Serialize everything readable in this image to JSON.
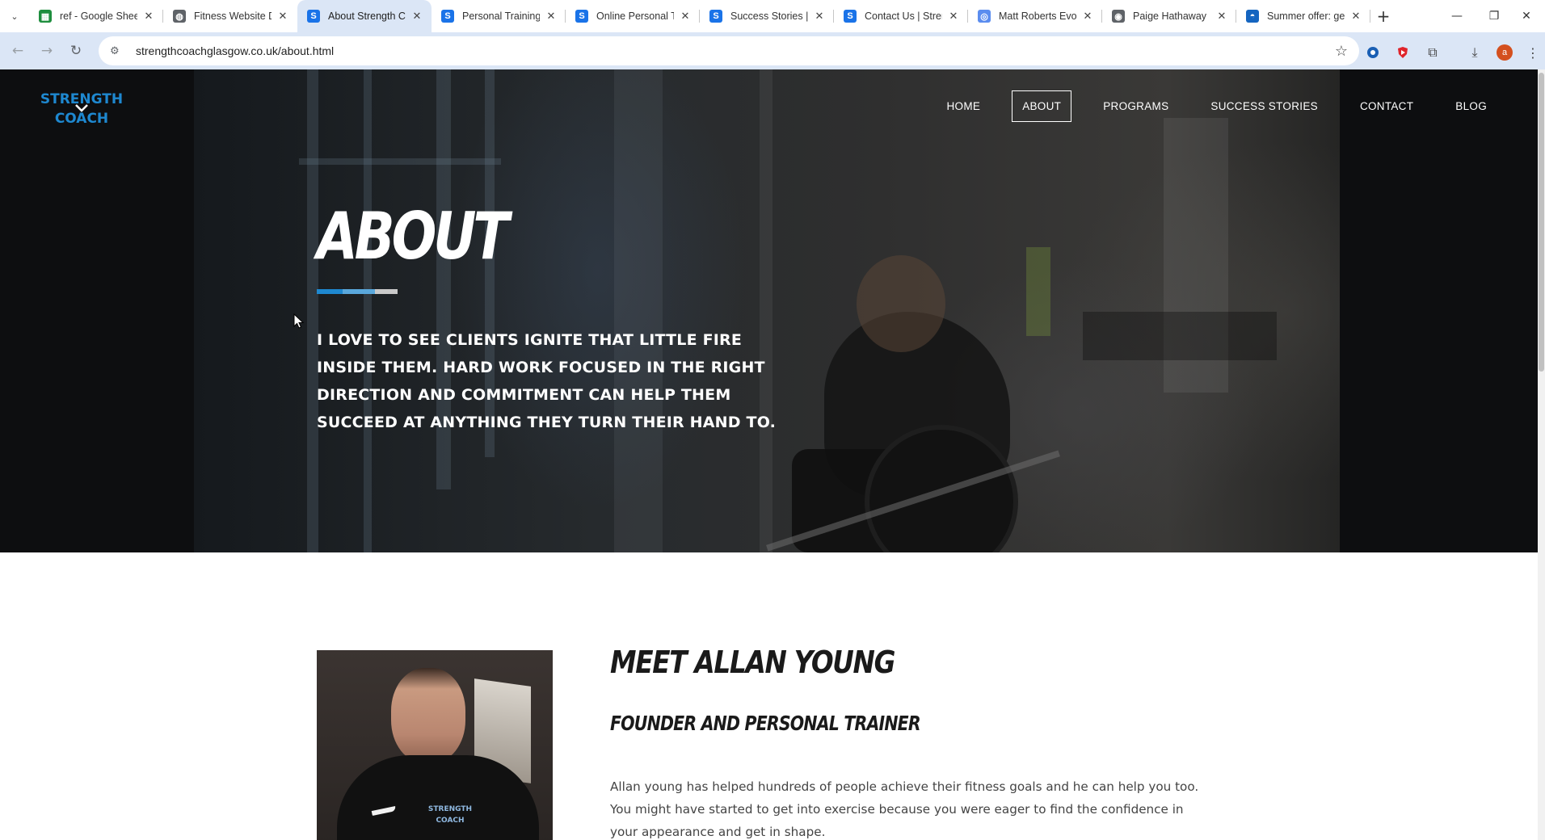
{
  "browser": {
    "tabs": [
      {
        "title": "ref - Google Shee",
        "favicon": "sheets-icon",
        "color": "#1e8e3e",
        "glyph": "▦"
      },
      {
        "title": "Fitness Website D",
        "favicon": "chat-icon",
        "color": "#5f6368",
        "glyph": "◍"
      },
      {
        "title": "About Strength C",
        "favicon": "s-logo-icon",
        "color": "#1a73e8",
        "glyph": "S"
      },
      {
        "title": "Personal Training",
        "favicon": "s-logo-icon",
        "color": "#1a73e8",
        "glyph": "S"
      },
      {
        "title": "Online Personal T",
        "favicon": "s-logo-icon",
        "color": "#1a73e8",
        "glyph": "S"
      },
      {
        "title": "Success Stories | S",
        "favicon": "s-logo-icon",
        "color": "#1a73e8",
        "glyph": "S"
      },
      {
        "title": "Contact Us | Stren",
        "favicon": "s-logo-icon",
        "color": "#1a73e8",
        "glyph": "S"
      },
      {
        "title": "Matt Roberts Evol",
        "favicon": "globe-icon",
        "color": "#5b8def",
        "glyph": "◎"
      },
      {
        "title": "Paige Hathaway",
        "favicon": "globe-icon",
        "color": "#5f6368",
        "glyph": "◉"
      },
      {
        "title": "Summer offer: ge",
        "favicon": "brand-icon",
        "color": "#1565c0",
        "glyph": "◓"
      }
    ],
    "active_tab": 2,
    "url": "strengthcoachglasgow.co.uk/about.html",
    "profile_initial": "a"
  },
  "site": {
    "logo_top": "STRENGTH",
    "logo_bottom": "COACH",
    "brand_color": "#1e88d0",
    "nav": [
      "HOME",
      "ABOUT",
      "PROGRAMS",
      "SUCCESS STORIES",
      "CONTACT",
      "BLOG"
    ],
    "nav_active": 1
  },
  "hero": {
    "title": "ABOUT",
    "quote": "I LOVE TO SEE CLIENTS IGNITE THAT LITTLE FIRE INSIDE THEM. HARD WORK FOCUSED IN THE RIGHT DIRECTION AND COMMITMENT CAN HELP THEM SUCCEED AT ANYTHING THEY TURN THEIR HAND TO.",
    "accent_colors": [
      "#1e88d0",
      "#5aa8dc",
      "#c9c9c9"
    ]
  },
  "meet": {
    "heading": "MEET ALLAN YOUNG",
    "subheading": "FOUNDER AND PERSONAL TRAINER",
    "paragraph": "Allan young has helped hundreds of people achieve their fitness goals and he can help you too. You might have started to get into exercise because you were eager to find the confidence in your appearance and get in shape.",
    "shirt_logo_top": "STRENGTH",
    "shirt_logo_bottom": "COACH"
  }
}
